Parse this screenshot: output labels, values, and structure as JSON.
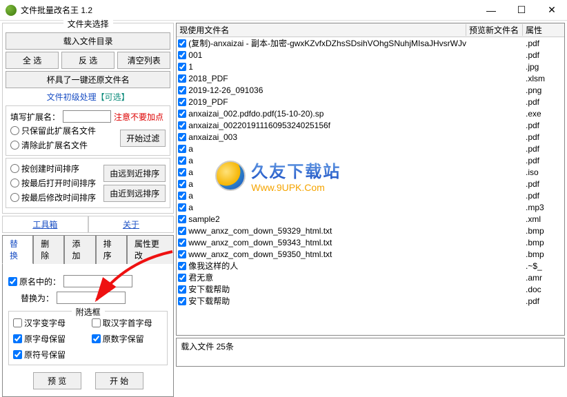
{
  "window": {
    "title": "文件批量改名王  1.2"
  },
  "folder_select": {
    "title": "文件夹选择",
    "load_dir": "载入文件目录",
    "select_all": "全 选",
    "invert": "反 选",
    "clear": "清空列表",
    "restore": "杯具了一键还原文件名"
  },
  "pre": {
    "title": "文件初级处理【可选】",
    "ext_label": "填写扩展名：",
    "ext_warn": "注意不要加点",
    "keep_ext": "只保留此扩展名文件",
    "remove_ext": "清除此扩展名文件",
    "start_filter": "开始过滤",
    "sort_create": "按创建时间排序",
    "sort_open": "按最后打开时间排序",
    "sort_modify": "按最后修改时间排序",
    "far_to_near": "由远到近排序",
    "near_to_far": "由近到远排序"
  },
  "toolbox": {
    "toolbox": "工具箱",
    "about": "关于"
  },
  "tabs": {
    "replace": "替换",
    "delete": "删除",
    "add": "添加",
    "sort": "排序",
    "attr": "属性更改"
  },
  "replace_tab": {
    "in_name": "原名中的：",
    "replace_with": "替换为：",
    "opt_title": "附选框",
    "hanzi_to_letter": "汉字变字母",
    "hanzi_initial": "取汉字首字母",
    "keep_letters": "原字母保留",
    "keep_digits": "原数字保留",
    "keep_symbols": "原符号保留",
    "preview": "预 览",
    "start": "开 始"
  },
  "columns": {
    "current": "现使用文件名",
    "preview": "预览新文件名",
    "ext": "属性"
  },
  "files": [
    {
      "name": "(复制)-anxaizai - 副本-加密-gwxKZvfxDZhsSDsihVOhgSNuhjMIsaJHvsrWJv",
      "ext": ".pdf"
    },
    {
      "name": "001",
      "ext": ".pdf"
    },
    {
      "name": "1",
      "ext": ".jpg"
    },
    {
      "name": "2018_PDF",
      "ext": ".xlsm"
    },
    {
      "name": "2019-12-26_091036",
      "ext": ".png"
    },
    {
      "name": "2019_PDF",
      "ext": ".pdf"
    },
    {
      "name": "anxaizai_002.pdfdo.pdf(15-10-20).sp",
      "ext": ".exe"
    },
    {
      "name": "anxaizai_00220191116095324025156f",
      "ext": ".pdf"
    },
    {
      "name": "anxaizai_003",
      "ext": ".pdf"
    },
    {
      "name": "a",
      "ext": ".pdf"
    },
    {
      "name": "a",
      "ext": ".pdf"
    },
    {
      "name": "a",
      "ext": ".iso"
    },
    {
      "name": "a",
      "ext": ".pdf"
    },
    {
      "name": "a",
      "ext": ".pdf"
    },
    {
      "name": "a",
      "ext": ".mp3"
    },
    {
      "name": "sample2",
      "ext": ".xml"
    },
    {
      "name": "www_anxz_com_down_59329_html.txt",
      "ext": ".bmp"
    },
    {
      "name": "www_anxz_com_down_59343_html.txt",
      "ext": ".bmp"
    },
    {
      "name": "www_anxz_com_down_59350_html.txt",
      "ext": ".bmp"
    },
    {
      "name": "像我这样的人",
      "ext": ".~$_"
    },
    {
      "name": "君无意",
      "ext": ".amr"
    },
    {
      "name": "安下载帮助",
      "ext": ".doc"
    },
    {
      "name": "安下载帮助",
      "ext": ".pdf"
    }
  ],
  "status": {
    "loaded": "载入文件  25条"
  },
  "watermark": {
    "cn": "久友下载站",
    "url": "Www.9UPK.Com"
  },
  "icons": {
    "minimize": "—",
    "maximize": "☐",
    "close": "✕"
  }
}
